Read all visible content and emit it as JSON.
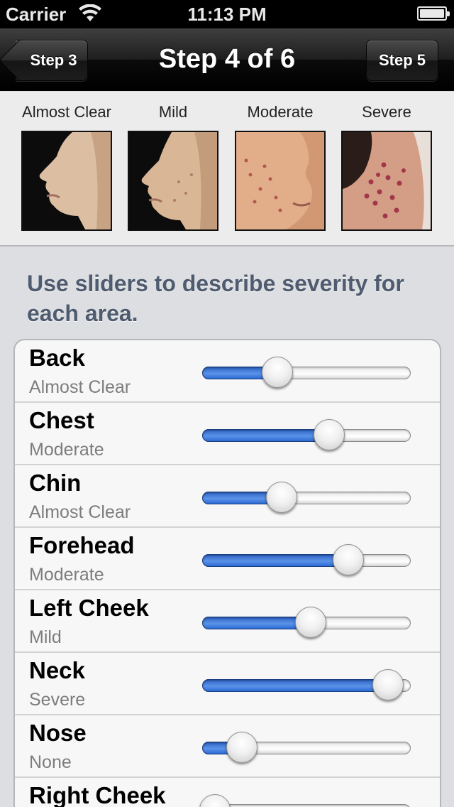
{
  "status_bar": {
    "carrier": "Carrier",
    "time": "11:13 PM"
  },
  "nav": {
    "title": "Step 4 of 6",
    "back_label": "Step 3",
    "forward_label": "Step 5"
  },
  "severity_reference": [
    {
      "label": "Almost Clear",
      "icon": "face-photo-almost-clear"
    },
    {
      "label": "Mild",
      "icon": "face-photo-mild"
    },
    {
      "label": "Moderate",
      "icon": "face-photo-moderate"
    },
    {
      "label": "Severe",
      "icon": "face-photo-severe"
    }
  ],
  "instruction": "Use sliders to describe severity for each area.",
  "areas": [
    {
      "name": "Back",
      "severity": "Almost Clear",
      "level": 0.36
    },
    {
      "name": "Chest",
      "severity": "Moderate",
      "level": 0.61
    },
    {
      "name": "Chin",
      "severity": "Almost Clear",
      "level": 0.38
    },
    {
      "name": "Forehead",
      "severity": "Moderate",
      "level": 0.7
    },
    {
      "name": "Left Cheek",
      "severity": "Mild",
      "level": 0.52
    },
    {
      "name": "Neck",
      "severity": "Severe",
      "level": 0.89
    },
    {
      "name": "Nose",
      "severity": "None",
      "level": 0.19
    },
    {
      "name": "Right Cheek",
      "severity": "",
      "level": 0.06
    }
  ],
  "colors": {
    "slider_fill": "#3a76d8",
    "instruction_text": "#4f5b6e"
  }
}
